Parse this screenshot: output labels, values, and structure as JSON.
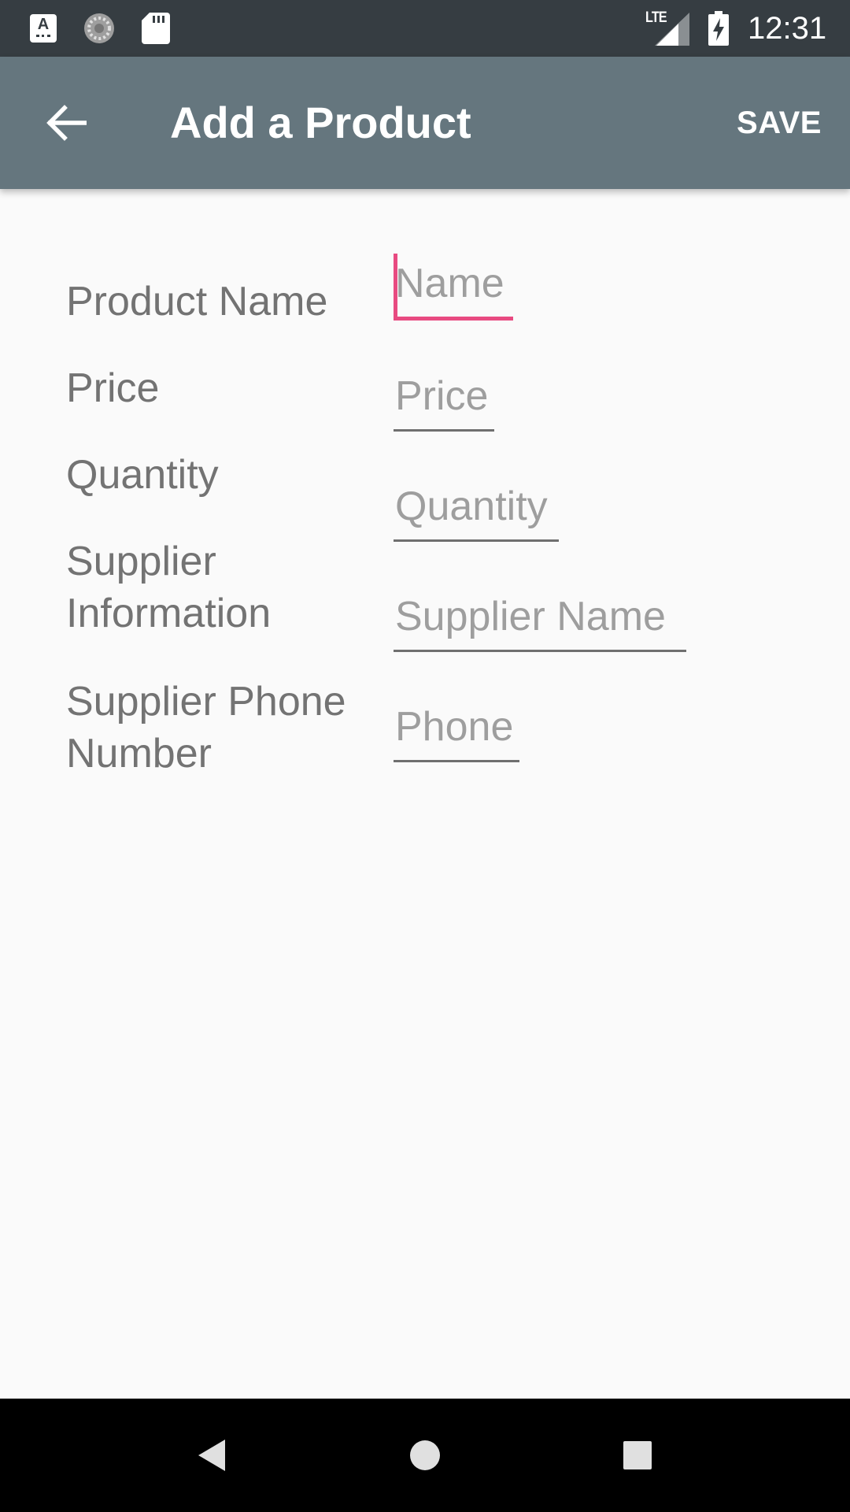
{
  "status_bar": {
    "keyboard_icon_letter": "A",
    "network_label": "LTE",
    "time": "12:31",
    "icons": [
      "keyboard-icon",
      "sync-icon",
      "sd-card-icon",
      "signal-icon",
      "battery-charging-icon"
    ]
  },
  "app_bar": {
    "back_icon": "arrow-back-icon",
    "title": "Add a Product",
    "save_label": "SAVE",
    "background_color": "#65767e"
  },
  "form": {
    "fields": [
      {
        "label": "Product Name",
        "placeholder": "Name",
        "value": "",
        "focused": true
      },
      {
        "label": "Price",
        "placeholder": "Price",
        "value": ""
      },
      {
        "label": "Quantity",
        "placeholder": "Quantity",
        "value": ""
      },
      {
        "label_line1": "Supplier",
        "label_line2": "Information",
        "placeholder": "Supplier Name",
        "value": ""
      },
      {
        "label_line1": "Supplier Phone",
        "label_line2": "Number",
        "placeholder": "Phone",
        "value": ""
      }
    ],
    "accent_color": "#e84a81"
  },
  "nav_bar": {
    "icons": [
      "back-triangle-icon",
      "home-circle-icon",
      "recents-square-icon"
    ]
  }
}
